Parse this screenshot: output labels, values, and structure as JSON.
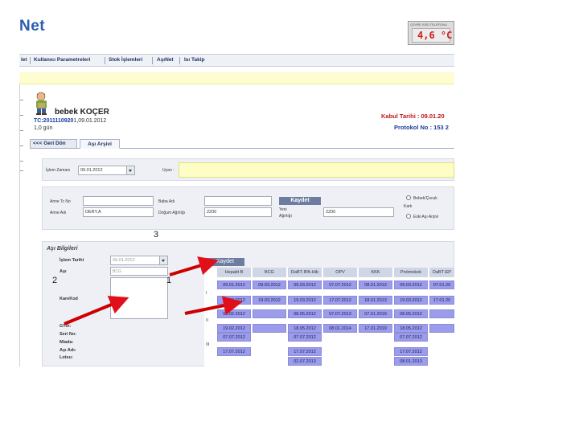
{
  "app": {
    "logo_text": "Net",
    "thermometer_label": "ÇEVRE ISISI TELEFONU",
    "temperature": "4,6 °C"
  },
  "menu": {
    "items": [
      {
        "label": "let"
      },
      {
        "label": "Kullanıcı Parametreleri"
      },
      {
        "label": "Stok İşlemleri"
      },
      {
        "label": "AşıNet"
      },
      {
        "label": "Isı Takip"
      }
    ]
  },
  "patient": {
    "name": "bebek KOÇER",
    "tc_label": "TC:",
    "tc_number": "2011110920",
    "tc_suffix": "1,09.01.2012",
    "age": "1,0 gün",
    "kabul": "Kabul Tarihi : 09.01.20",
    "protokol": "Protokol No : 153 2"
  },
  "tabs": {
    "back": "<<< Geri Dön",
    "active": "Aşı Arşivi"
  },
  "form1": {
    "islem_zamani_label": "İşlem Zamanı",
    "islem_zamani_value": "09.01.2012",
    "uyari_label": "Uyarı :"
  },
  "form2": {
    "anne_tc_label": "Anne Tc No",
    "anne_tc_value": "",
    "baba_adi_label": "Baba Adı",
    "baba_adi_value": "",
    "kaydet_label": "Kaydet",
    "radio1_label": "Bebek/Çocuk",
    "radio1_sub": "Kartı",
    "radio2_label": "Eski Aşı Arşivi",
    "anne_adi_label": "Anne Adı",
    "anne_adi_value": "DERY.A",
    "dogum_agirligi_label": "Doğum Ağırlığı",
    "dogum_agirligi_value": "2200",
    "yeni_agirligi_label": "Yeni",
    "yeni_agirligi_label2": "Ağırlığı",
    "yeni_agirligi_value": "2200"
  },
  "asi_bilgileri": {
    "title": "Aşı Bilgileri",
    "islem_tarihi_label": "İşlem Tarihi",
    "islem_tarihi_value": "09.01.2012",
    "asi_label": "Aşı",
    "asi_value": "BCG",
    "karekod_label": "KareKod",
    "gtin_label": "GTin:",
    "seri_label": "Seri No:",
    "miad_label": "Miada:",
    "asi_adi_label": "Aşı Adı:",
    "lot_label": "Lotsu:",
    "kaydet_label": "Kaydet"
  },
  "vaccine_table": {
    "headers": [
      "Hepatit B",
      "BCG",
      "DaBT-IPA-Hib",
      "OPV",
      "KKK",
      "Pnömokok",
      "DaBT-EP"
    ],
    "row_labels": [
      "I",
      "II",
      "III"
    ],
    "rows": [
      [
        "09.01.2012",
        "09.03.2012",
        "09.03.2012",
        "07.07.2012",
        "08.01.2013",
        "09.03.2012",
        "07.01.20"
      ],
      [
        "19.03.2012",
        "19.03.2012",
        "19.03.2012",
        "17.07.2012",
        "18.01.2013",
        "19.03.2012",
        "17.01.20"
      ],
      [
        "09.02.2012",
        "",
        "08.05.2012",
        "07.07.2013",
        "07.01.2019",
        "08.05.2012",
        ""
      ],
      [
        "19.02.2012",
        "",
        "18.05.2012",
        "08.01.2014",
        "17.01.2019",
        "18.05.2012",
        ""
      ],
      [
        "07.07.2012",
        "",
        "07.07.2012",
        "",
        "",
        "07.07.2012",
        ""
      ],
      [
        "17.07.2012",
        "",
        "17.07.2012",
        "",
        "",
        "17.07.2012",
        ""
      ],
      [
        "",
        "",
        "02.07.2013",
        "",
        "",
        "08.01.2013",
        ""
      ]
    ]
  },
  "annotations": {
    "label_1": "1",
    "label_2": "2",
    "label_3": "3"
  }
}
